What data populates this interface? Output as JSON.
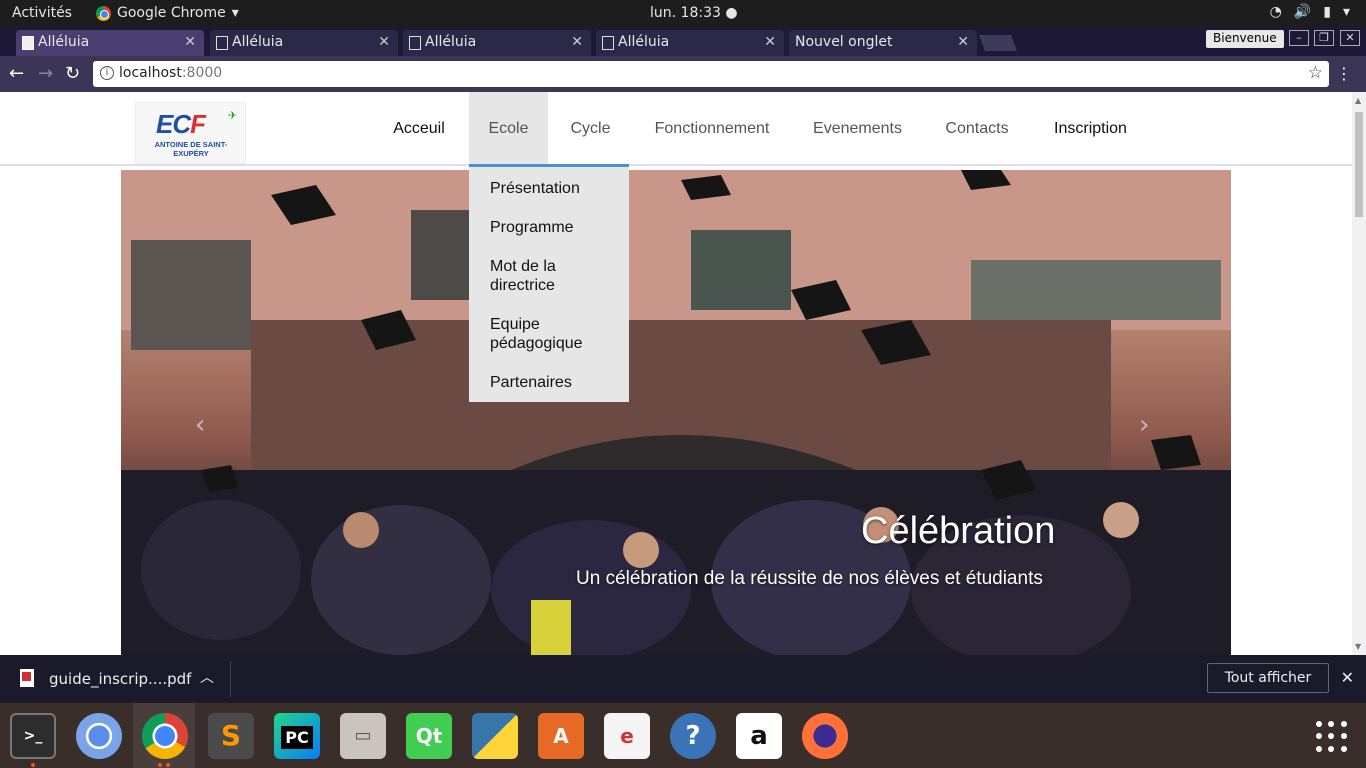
{
  "system_bar": {
    "activities": "Activités",
    "app_name": "Google Chrome",
    "clock": "lun. 18:33"
  },
  "browser": {
    "tabs": [
      {
        "label": "Alléluia",
        "active": true
      },
      {
        "label": "Alléluia",
        "active": false
      },
      {
        "label": "Alléluia",
        "active": false
      },
      {
        "label": "Alléluia",
        "active": false
      },
      {
        "label": "Nouvel onglet",
        "active": false
      }
    ],
    "profile_button": "Bienvenue",
    "url_host": "localhost",
    "url_port": ":8000"
  },
  "site": {
    "logo": {
      "title": "ECF",
      "subtitle": "ANTOINE DE SAINT-EXUPÉRY"
    },
    "nav": [
      {
        "label": "Acceuil"
      },
      {
        "label": "Ecole"
      },
      {
        "label": "Cycle"
      },
      {
        "label": "Fonctionnement"
      },
      {
        "label": "Evenements"
      },
      {
        "label": "Contacts"
      },
      {
        "label": "Inscription"
      }
    ],
    "dropdown": [
      {
        "label": "Présentation"
      },
      {
        "label": "Programme"
      },
      {
        "label": "Mot de la directrice"
      },
      {
        "label": "Equipe pédagogique"
      },
      {
        "label": "Partenaires"
      }
    ],
    "carousel": {
      "title": "Célébration",
      "subtitle": "Un célébration de la réussite de nos élèves et étudiants"
    }
  },
  "downloads": {
    "file_name": "guide_inscrip....pdf",
    "show_all": "Tout afficher"
  },
  "dock": {
    "apps": [
      "terminal-icon",
      "chromium-icon",
      "chrome-icon",
      "sublime-text-icon",
      "pycharm-icon",
      "file-manager-icon",
      "qt-creator-icon",
      "python-icon",
      "software-center-icon",
      "document-viewer-icon",
      "help-icon",
      "amazon-icon",
      "firefox-icon"
    ]
  }
}
